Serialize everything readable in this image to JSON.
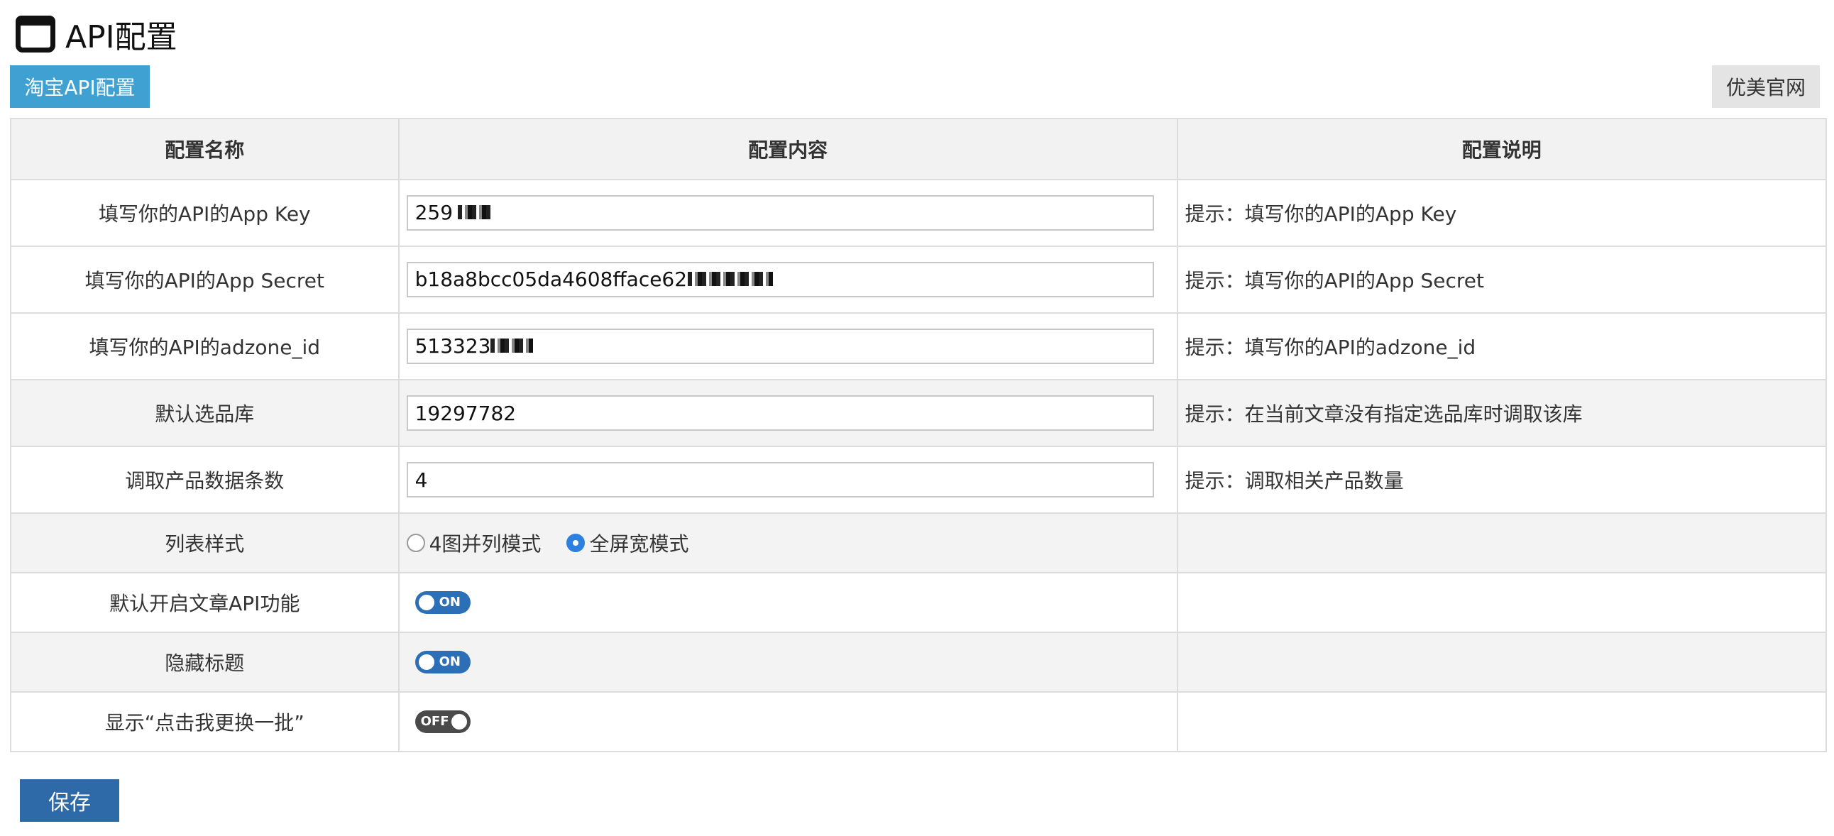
{
  "page": {
    "title": "API配置"
  },
  "tabs": {
    "taobao_label": "淘宝API配置",
    "site_label": "优美官网"
  },
  "table": {
    "headers": {
      "name": "配置名称",
      "content": "配置内容",
      "desc": "配置说明"
    },
    "rows": [
      {
        "name": "填写你的API的App Key",
        "value": "259",
        "desc": "提示：填写你的API的App Key"
      },
      {
        "name": "填写你的API的App Secret",
        "value": "b18a8bcc05da4608fface62",
        "desc": "提示：填写你的API的App Secret"
      },
      {
        "name": "填写你的API的adzone_id",
        "value": "513323",
        "desc": "提示：填写你的API的adzone_id"
      },
      {
        "name": "默认选品库",
        "value": "19297782",
        "desc": "提示：在当前文章没有指定选品库时调取该库"
      },
      {
        "name": "调取产品数据条数",
        "value": "4",
        "desc": "提示：调取相关产品数量"
      },
      {
        "name": "列表样式",
        "options": [
          "4图并列模式",
          "全屏宽模式"
        ],
        "selected": "全屏宽模式"
      },
      {
        "name": "默认开启文章API功能",
        "toggle": "ON"
      },
      {
        "name": "隐藏标题",
        "toggle": "ON"
      },
      {
        "name": "显示“点击我更换一批”",
        "toggle": "OFF"
      }
    ]
  },
  "actions": {
    "save_label": "保存"
  },
  "colors": {
    "accent": "#3ea1d2",
    "save": "#2e6aa7",
    "toggle_on": "#2d6fb7",
    "toggle_off": "#4a4a4a",
    "radio_on": "#2d7fe0"
  }
}
